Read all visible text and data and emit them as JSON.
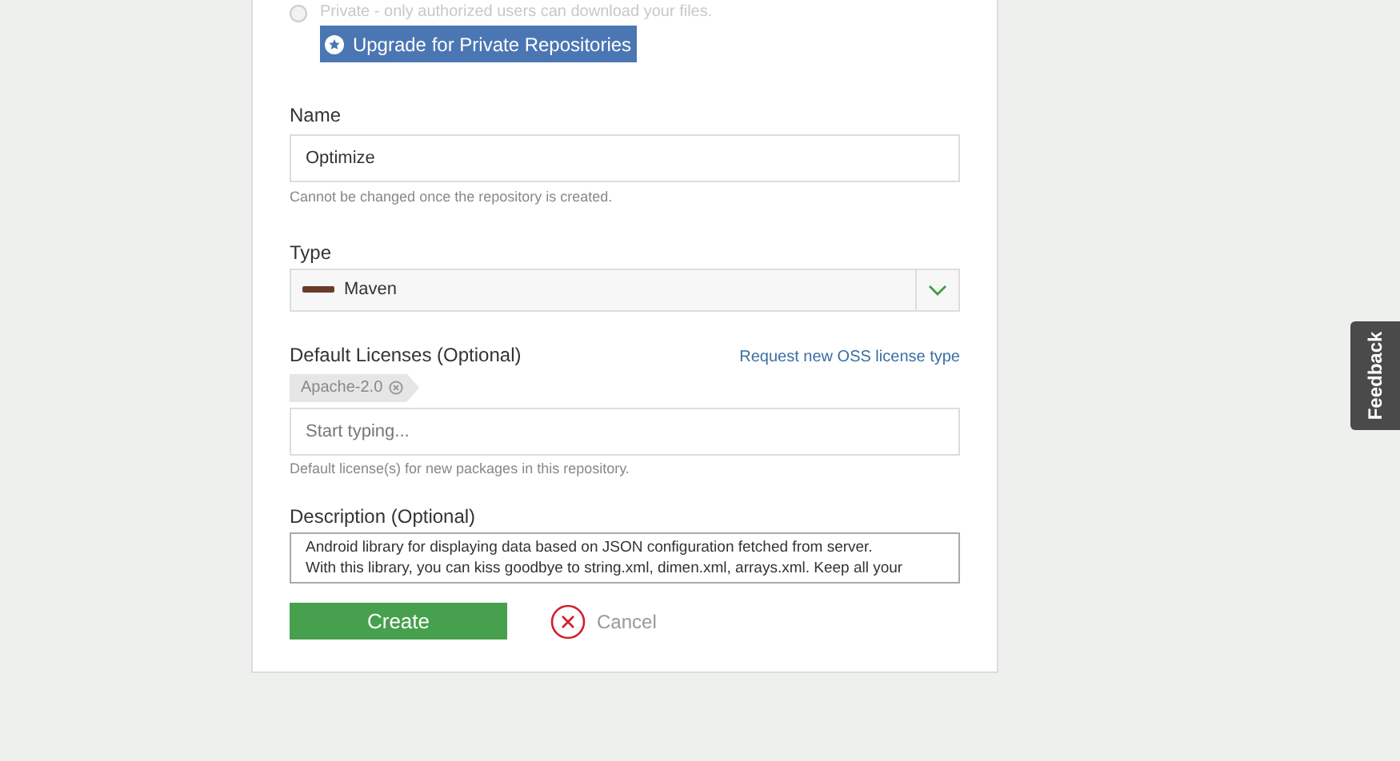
{
  "visibility_option": {
    "label": "Private - only authorized users can download your files.",
    "selected": false
  },
  "upgrade_button": "Upgrade for Private Repositories",
  "name_field": {
    "label": "Name",
    "value": "Optimize",
    "hint": "Cannot be changed once the repository is created."
  },
  "type_field": {
    "label": "Type",
    "value": "Maven"
  },
  "licenses": {
    "label": "Default Licenses (Optional)",
    "link": "Request new OSS license type",
    "tags": [
      "Apache-2.0"
    ],
    "placeholder": "Start typing...",
    "hint": "Default license(s) for new packages in this repository."
  },
  "description": {
    "label": "Description (Optional)",
    "value": "Android library for displaying data based on JSON configuration fetched from server.\nWith this library, you can kiss goodbye to string.xml, dimen.xml, arrays.xml. Keep all your"
  },
  "buttons": {
    "create": "Create",
    "cancel": "Cancel"
  },
  "feedback_tab": "Feedback"
}
